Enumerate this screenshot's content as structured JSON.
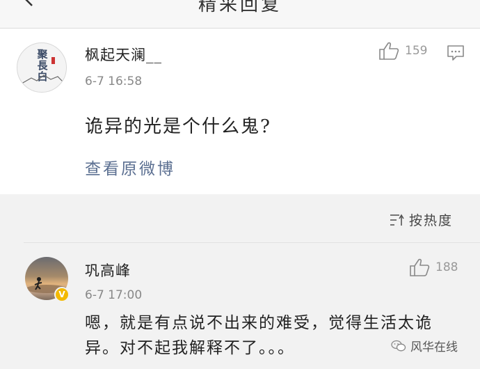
{
  "header": {
    "title": "精采回复"
  },
  "post": {
    "username": "枫起天澜__",
    "avatar_text": "聚長白",
    "timestamp": "6-7 16:58",
    "likes": "159",
    "content": "诡异的光是个什么鬼?",
    "view_original": "查看原微博"
  },
  "sort": {
    "label": "按热度"
  },
  "comment": {
    "username": "巩高峰",
    "timestamp": "6-7 17:00",
    "likes": "188",
    "content": "嗯，就是有点说不出来的难受，觉得生活太诡异。对不起我解释不了。。。",
    "verified_badge": "V"
  },
  "watermark": {
    "text": "风华在线"
  },
  "icons": {
    "back": "chevron-left-icon",
    "like": "thumbs-up-icon",
    "comment": "comment-bubble-icon",
    "sort": "sort-icon",
    "watermark": "wechat-icon"
  },
  "colors": {
    "link": "#5b6f91",
    "badge": "#f3b900"
  }
}
